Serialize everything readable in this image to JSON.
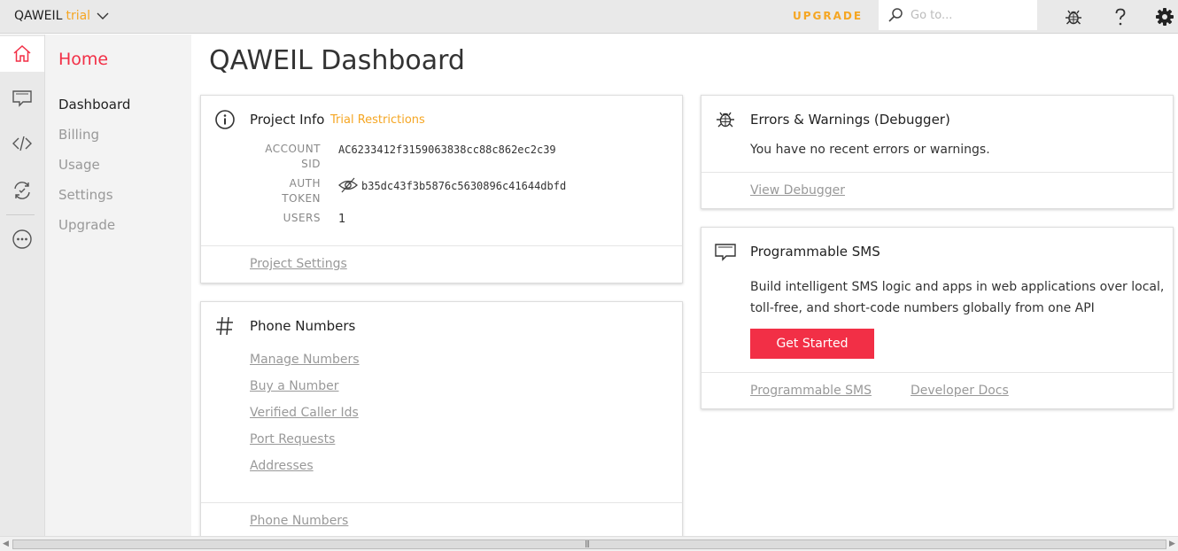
{
  "topbar": {
    "account_name": "QAWEIL",
    "account_type": "trial",
    "upgrade_label": "UPGRADE",
    "search_placeholder": "Go to..."
  },
  "rail": {
    "items": [
      {
        "icon": "home-icon",
        "active": true
      },
      {
        "icon": "chat-icon"
      },
      {
        "icon": "code-icon"
      },
      {
        "icon": "sync-icon"
      },
      {
        "icon": "more-icon"
      }
    ]
  },
  "sidebar": {
    "section_title": "Home",
    "items": [
      {
        "label": "Dashboard",
        "active": true
      },
      {
        "label": "Billing"
      },
      {
        "label": "Usage"
      },
      {
        "label": "Settings"
      },
      {
        "label": "Upgrade"
      }
    ]
  },
  "main": {
    "title": "QAWEIL Dashboard",
    "project_info": {
      "title": "Project Info",
      "trial_link": "Trial Restrictions",
      "account_sid_label_1": "ACCOUNT",
      "account_sid_label_2": "SID",
      "account_sid": "AC6233412f3159063838cc88c862ec2c39",
      "auth_token_label_1": "AUTH",
      "auth_token_label_2": "TOKEN",
      "auth_token": "b35dc43f3b5876c5630896c41644dbfd",
      "users_label": "USERS",
      "users": "1",
      "footer_link": "Project Settings"
    },
    "phone_numbers": {
      "title": "Phone Numbers",
      "links": [
        "Manage Numbers",
        "Buy a Number",
        "Verified Caller Ids",
        "Port Requests",
        "Addresses"
      ],
      "footer_link": "Phone Numbers"
    },
    "errors": {
      "title": "Errors & Warnings (Debugger)",
      "message": "You have no recent errors or warnings.",
      "footer_link": "View Debugger"
    },
    "sms": {
      "title": "Programmable SMS",
      "desc_line1": "Build intelligent SMS logic and apps in web applications over local,",
      "desc_line2": "toll-free, and short-code numbers globally from one API",
      "button": "Get Started",
      "footer_link_1": "Programmable SMS",
      "footer_link_2": "Developer Docs"
    }
  },
  "colors": {
    "accent_red": "#f22f46",
    "trial_orange": "#f5a623"
  }
}
